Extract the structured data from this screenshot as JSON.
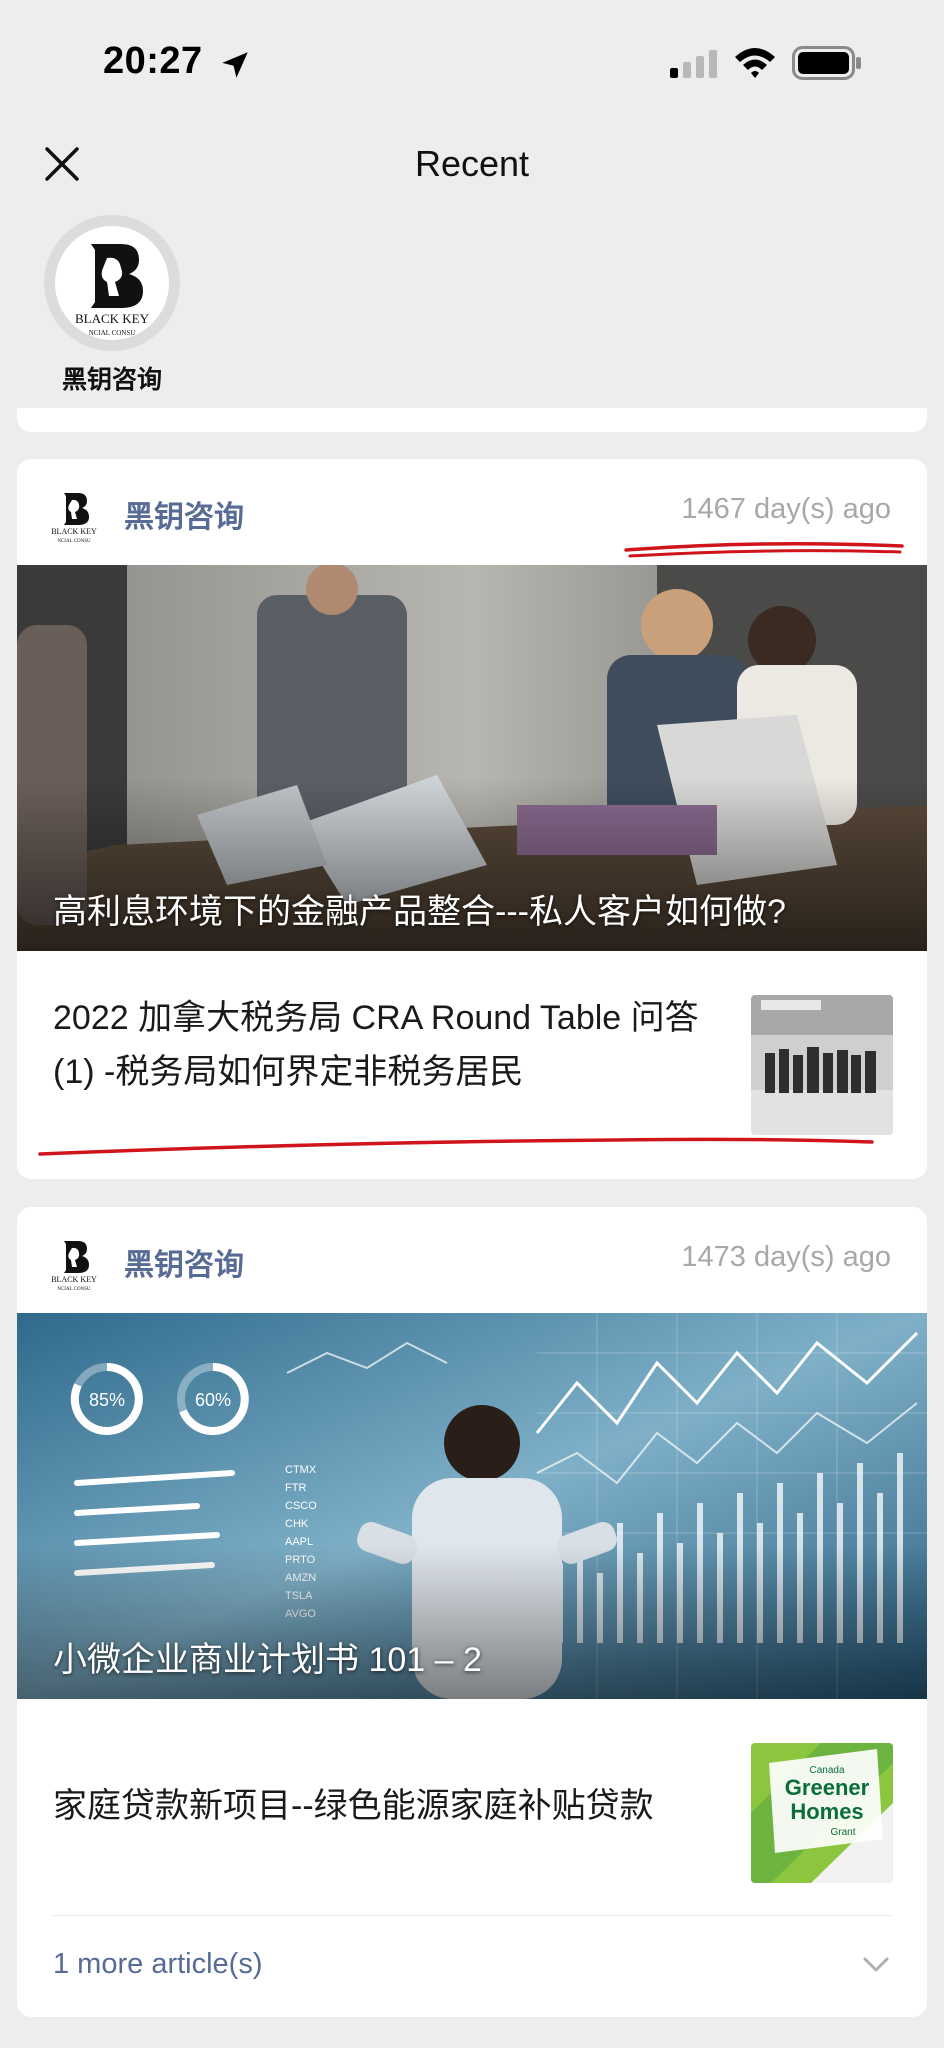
{
  "status_bar": {
    "time": "20:27"
  },
  "header": {
    "title": "Recent"
  },
  "account": {
    "name": "黑钥咨询",
    "logo_text": "BLACK KEY",
    "logo_subtext": "NCIAL CONSU"
  },
  "posts": [
    {
      "source": "黑钥咨询",
      "time_ago": "1467 day(s) ago",
      "hero_title": "高利息环境下的金融产品整合---私人客户如何做?",
      "articles": [
        {
          "title": "2022 加拿大税务局 CRA Round Table 问答 (1) -税务局如何界定非税务居民"
        }
      ]
    },
    {
      "source": "黑钥咨询",
      "time_ago": "1473 day(s) ago",
      "hero_title": "小微企业商业计划书 101 – 2",
      "hero_gauges": [
        "85%",
        "60%"
      ],
      "hero_tickers": [
        "CTMX",
        "FTR",
        "CSCO",
        "CHK",
        "AAPL",
        "PRTO",
        "AMZN",
        "TSLA",
        "AVGO"
      ],
      "articles": [
        {
          "title": "家庭贷款新项目--绿色能源家庭补贴贷款",
          "thumb_text": [
            "Canada",
            "Greener",
            "Homes",
            "Grant"
          ]
        }
      ],
      "more_label": "1 more article(s)"
    }
  ],
  "colors": {
    "link": "#576b95",
    "muted": "#a8a8a8",
    "annotation": "#d0141c",
    "background": "#ededed"
  }
}
